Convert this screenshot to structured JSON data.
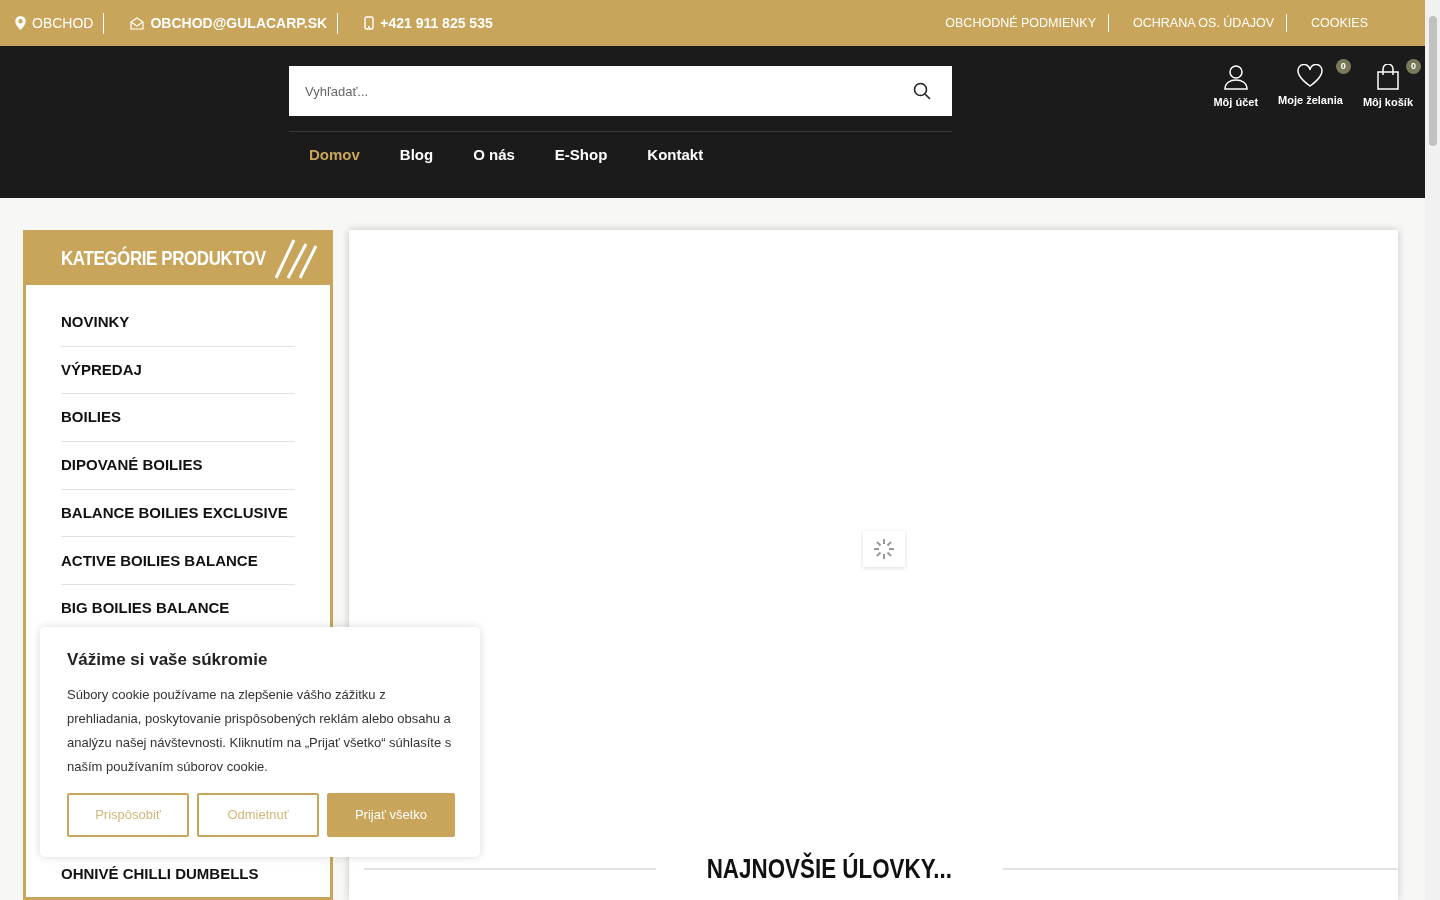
{
  "top_bar": {
    "contacts": [
      {
        "kind": "location",
        "text": "OBCHOD"
      },
      {
        "kind": "email",
        "text": "OBCHOD@GULACARP.SK"
      },
      {
        "kind": "phone",
        "text": "+421 911 825 535"
      }
    ],
    "links": [
      "OBCHODNÉ PODMIENKY",
      "OCHRANA OS. ÚDAJOV",
      "COOKIES"
    ]
  },
  "search": {
    "placeholder": "Vyhľadať..."
  },
  "account_links": [
    {
      "kind": "account",
      "label": "Môj účet"
    },
    {
      "kind": "wishlist",
      "label": "Moje želania",
      "count": "0"
    },
    {
      "kind": "cart",
      "label": "Môj košík",
      "count": "0"
    }
  ],
  "nav": [
    {
      "label": "Domov",
      "selected": true
    },
    {
      "label": "Blog",
      "selected": false
    },
    {
      "label": "O nás",
      "selected": false
    },
    {
      "label": "E-Shop",
      "selected": false
    },
    {
      "label": "Kontakt",
      "selected": false
    }
  ],
  "sidebar": {
    "title": "KATEGÓRIE PRODUKTOV",
    "items": [
      "NOVINKY",
      "VÝPREDAJ",
      "BOILIES",
      "DIPOVANÉ BOILIES",
      "BALANCE BOILIES EXCLUSIVE",
      "ACTIVE BOILIES BALANCE",
      "BIG BOILIES BALANCE",
      "OHNIVÉ CHILLI DUMBELLS"
    ]
  },
  "section_heading": "NAJNOVŠIE ÚLOVKY...",
  "cookie_banner": {
    "title": "Vážime si vaše súkromie",
    "text": "Súbory cookie používame na zlepšenie vášho zážitku z prehliadania, poskytovanie prispôsobených reklám alebo obsahu a analýzu našej návštevnosti. Kliknutím na „Prijať všetko“ súhlasíte s naším používaním súborov cookie.",
    "buttons": [
      {
        "label": "Prispôsobiť",
        "kind": "outline"
      },
      {
        "label": "Odmietnuť",
        "kind": "outline"
      },
      {
        "label": "Prijať všetko",
        "kind": "filled"
      }
    ]
  }
}
